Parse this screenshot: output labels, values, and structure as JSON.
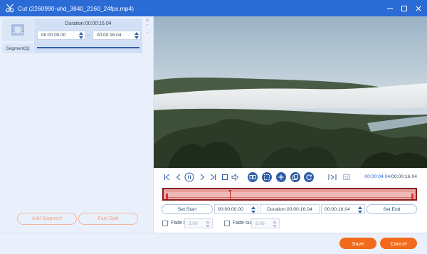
{
  "window": {
    "title": "Cut (2260990-uhd_3840_2160_24fps.mp4)",
    "minimize_icon": "minimize-icon",
    "close_icon": "close-icon"
  },
  "segment_list": {
    "items": [
      {
        "label": "Segment[1]",
        "duration": "Duration:00:00:16.04",
        "start": "00:00:00.00",
        "end": "00:00:16.04"
      }
    ],
    "add_segment_label": "Add Segment",
    "fast_split_label": "Fast Split"
  },
  "playback": {
    "current_time": "00:00:04.04",
    "total_time": "/00:00:16.04",
    "controls": [
      "jump-start-icon",
      "prev-frame-icon",
      "play-pause-icon",
      "next-frame-icon",
      "jump-end-icon",
      "stop-icon",
      "volume-icon",
      "copy-segment-icon",
      "split-icon",
      "add-icon",
      "duplicate-icon",
      "rotate-icon",
      "set-in-icon",
      "set-out-icon"
    ]
  },
  "timeline": {
    "selection_start_fraction": 0.0,
    "selection_end_fraction": 1.0,
    "playhead_fraction": 0.26
  },
  "trim": {
    "set_start_label": "Set Start",
    "start_time": "00:00:00.00",
    "duration": "Duration:00:00:16.04",
    "end_time": "00:00:16.04",
    "set_end_label": "Set End"
  },
  "fade": {
    "fade_in_label": "Fade in",
    "fade_in_value": "3.00",
    "fade_out_label": "Fade out",
    "fade_out_value": "3.00"
  },
  "footer": {
    "save_label": "Save",
    "cancel_label": "Cancel"
  },
  "colors": {
    "titlebar": "#2b6bd6",
    "accent": "#2f5fa8",
    "primary_button": "#f26a1b",
    "timeline_border": "#8a1c1c"
  }
}
